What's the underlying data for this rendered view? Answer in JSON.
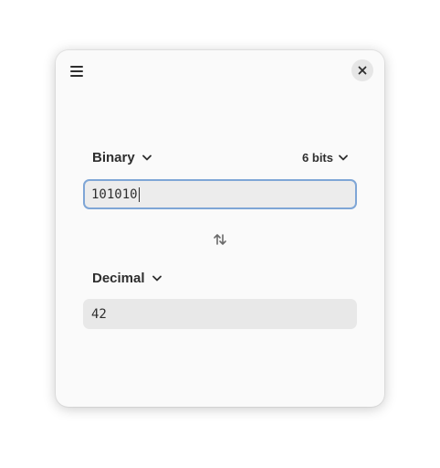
{
  "window": {
    "menu_icon": "hamburger-menu-icon",
    "close_icon": "close-icon"
  },
  "input_section": {
    "unit_label": "Binary",
    "bits_label": "6 bits",
    "value": "101010"
  },
  "swap_icon": "swap-arrows-icon",
  "output_section": {
    "unit_label": "Decimal",
    "value": "42"
  },
  "colors": {
    "focus_border": "#7fa6d6",
    "window_bg": "#fafafa",
    "field_bg": "#e8e8e8"
  }
}
